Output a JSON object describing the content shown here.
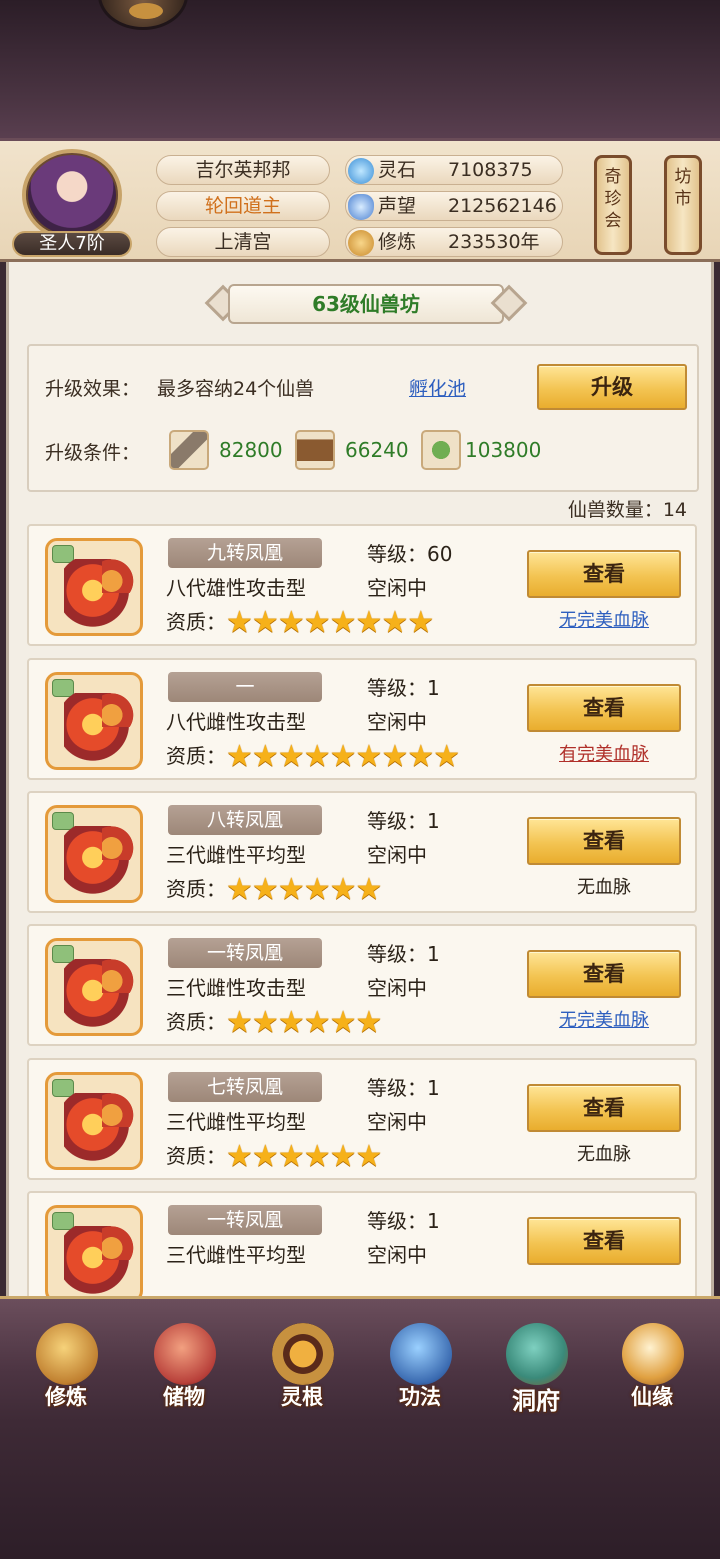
{
  "header": {
    "player_name": "吉尔英邦邦",
    "title": "轮回道主",
    "sect": "上清宫",
    "rank": "圣人7阶",
    "resources": [
      {
        "icon": "spirit-stone-icon",
        "label": "灵石",
        "value": "7108375"
      },
      {
        "icon": "reputation-icon",
        "label": "声望",
        "value": "212562146"
      },
      {
        "icon": "cultivation-icon",
        "label": "修炼",
        "value": "233530年"
      }
    ],
    "side_buttons": [
      {
        "label": "奇珍会"
      },
      {
        "label": "坊市"
      }
    ]
  },
  "page": {
    "title": "63级仙兽坊"
  },
  "upgrade": {
    "effect_label": "升级效果：",
    "effect_text": "最多容纳24个仙兽",
    "link_text": "孵化池",
    "button_label": "升级",
    "condition_label": "升级条件：",
    "materials": [
      {
        "icon": "ore-icon",
        "value": "82800"
      },
      {
        "icon": "wood-icon",
        "value": "66240"
      },
      {
        "icon": "herb-icon",
        "value": "103800"
      }
    ]
  },
  "beast_count": "仙兽数量：14",
  "beasts": [
    {
      "name": "九转凤凰",
      "generation": "八代雄性攻击型",
      "level": "等级：60",
      "status": "空闲中",
      "aptitude_label": "资质：",
      "stars": 8,
      "button": "查看",
      "bloodline": "无完美血脉",
      "bloodline_style": "link"
    },
    {
      "name": "一",
      "generation": "八代雌性攻击型",
      "level": "等级：1",
      "status": "空闲中",
      "aptitude_label": "资质：",
      "stars": 9,
      "button": "查看",
      "bloodline": "有完美血脉",
      "bloodline_style": "red"
    },
    {
      "name": "八转凤凰",
      "generation": "三代雌性平均型",
      "level": "等级：1",
      "status": "空闲中",
      "aptitude_label": "资质：",
      "stars": 6,
      "button": "查看",
      "bloodline": "无血脉",
      "bloodline_style": "plain"
    },
    {
      "name": "一转凤凰",
      "generation": "三代雌性攻击型",
      "level": "等级：1",
      "status": "空闲中",
      "aptitude_label": "资质：",
      "stars": 6,
      "button": "查看",
      "bloodline": "无完美血脉",
      "bloodline_style": "link"
    },
    {
      "name": "七转凤凰",
      "generation": "三代雌性平均型",
      "level": "等级：1",
      "status": "空闲中",
      "aptitude_label": "资质：",
      "stars": 6,
      "button": "查看",
      "bloodline": "无血脉",
      "bloodline_style": "plain"
    },
    {
      "name": "一转凤凰",
      "generation": "三代雌性平均型",
      "level": "等级：1",
      "status": "空闲中",
      "aptitude_label": "资质：",
      "stars": 0,
      "button": "查看",
      "bloodline": "",
      "bloodline_style": "plain"
    }
  ],
  "bottom_nav": [
    {
      "label": "修炼",
      "icon": "cultivate-icon"
    },
    {
      "label": "储物",
      "icon": "storage-bag-icon"
    },
    {
      "label": "灵根",
      "icon": "spirit-root-icon"
    },
    {
      "label": "功法",
      "icon": "technique-book-icon"
    },
    {
      "label": "洞府",
      "icon": "cave-mansion-icon",
      "active": true
    },
    {
      "label": "仙缘",
      "icon": "immortal-fate-icon"
    }
  ]
}
